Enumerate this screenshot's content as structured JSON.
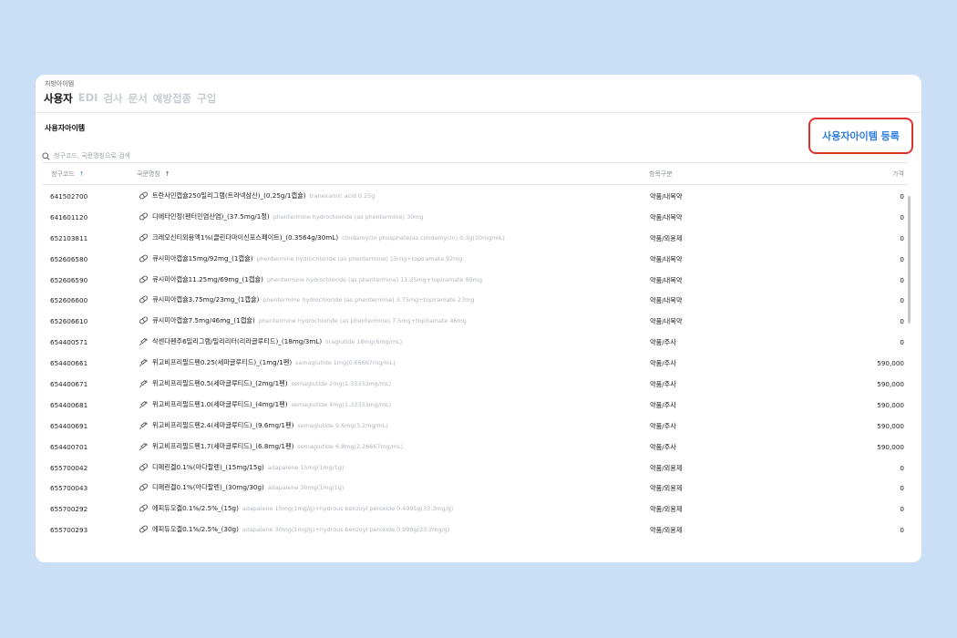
{
  "breadcrumb": "처방아이템",
  "tabs": [
    {
      "label": "사용자",
      "active": true
    },
    {
      "label": "EDI",
      "active": false
    },
    {
      "label": "검사",
      "active": false
    },
    {
      "label": "문서",
      "active": false
    },
    {
      "label": "예방접종",
      "active": false
    },
    {
      "label": "구입",
      "active": false
    }
  ],
  "section_title": "사용자아이템",
  "search": {
    "placeholder": "청구코드, 국문명칭으로 검색",
    "value": ""
  },
  "register_button": "사용자아이템 등록",
  "columns": {
    "code": "청구코드",
    "name": "국문명칭",
    "category": "항목구분",
    "price": "가격"
  },
  "colors": {
    "accent": "#2f7de1",
    "highlight_border": "#e0322c",
    "background": "#c9dff5"
  },
  "rows": [
    {
      "code": "641502700",
      "name": "트란사민캡슐250밀리그램(트라넥삼산)_(0.25g/1캡슐)",
      "ingredient": "tranexamic acid 0.25g",
      "category": "약품/내복약",
      "price": "0",
      "icon": "pill-icon"
    },
    {
      "code": "641601120",
      "name": "디에타민정(펜터민염산염)_(37.5mg/1정)",
      "ingredient": "phentermine hydrochloride (as phentermine) 30mg",
      "category": "약품/내복약",
      "price": "0",
      "icon": "pill-icon"
    },
    {
      "code": "652103811",
      "name": "크레오신티외용액1%(클린다마이신포스페이트)_(0.3564g/30mL)",
      "ingredient": "clindamycin phosphate(as clindamycin) 0.3g(10mg/mL)",
      "category": "약품/외용제",
      "price": "0",
      "icon": "pill-icon"
    },
    {
      "code": "652606580",
      "name": "큐시미아캡슐15mg/92mg_(1캡슐)",
      "ingredient": "phentermine hydrochloride (as phentermine) 15mg+topiramate 92mg",
      "category": "약품/내복약",
      "price": "0",
      "icon": "pill-icon"
    },
    {
      "code": "652606590",
      "name": "큐시미아캡슐11.25mg/69mg_(1캡슐)",
      "ingredient": "phentermine hydrochloride (as phentermine) 11.25mg+topiramate 69mg",
      "category": "약품/내복약",
      "price": "0",
      "icon": "pill-icon"
    },
    {
      "code": "652606600",
      "name": "큐시미아캡슐3.75mg/23mg_(1캡슐)",
      "ingredient": "phentermine hydrochloride (as phentermine) 3.75mg+topiramate 23mg",
      "category": "약품/내복약",
      "price": "0",
      "icon": "pill-icon"
    },
    {
      "code": "652606610",
      "name": "큐시미아캡슐7.5mg/46mg_(1캡슐)",
      "ingredient": "phentermine hydrochloride (as phentermine) 7.5mg+topiramate 46mg",
      "category": "약품/내복약",
      "price": "0",
      "icon": "pill-icon"
    },
    {
      "code": "654400571",
      "name": "삭센다펜주6밀리그램/밀리리터(리라글루티드)_(18mg/3mL)",
      "ingredient": "liraglutide 18mg(6mg/mL)",
      "category": "약품/주사",
      "price": "0",
      "icon": "syringe-icon"
    },
    {
      "code": "654400661",
      "name": "위고비프리필드펜0.25(세마글루티드)_(1mg/1펜)",
      "ingredient": "semaglutide 1mg(0.66667mg/mL)",
      "category": "약품/주사",
      "price": "590,000",
      "icon": "syringe-icon"
    },
    {
      "code": "654400671",
      "name": "위고비프리필드펜0.5(세마글루티드)_(2mg/1펜)",
      "ingredient": "semaglutide 2mg(1.33333mg/mL)",
      "category": "약품/주사",
      "price": "590,000",
      "icon": "syringe-icon"
    },
    {
      "code": "654400681",
      "name": "위고비프리필드펜1.0(세마글루티드)_(4mg/1펜)",
      "ingredient": "semaglutide 4mg(1.33333mg/mL)",
      "category": "약품/주사",
      "price": "590,000",
      "icon": "syringe-icon"
    },
    {
      "code": "654400691",
      "name": "위고비프리필드펜2.4(세마글루티드)_(9.6mg/1펜)",
      "ingredient": "semaglutide 9.6mg(3.2mg/mL)",
      "category": "약품/주사",
      "price": "590,000",
      "icon": "syringe-icon"
    },
    {
      "code": "654400701",
      "name": "위고비프리필드펜1.7(세마글루티드)_(6.8mg/1펜)",
      "ingredient": "semaglutide 6.8mg(2.26667mg/mL)",
      "category": "약품/주사",
      "price": "590,000",
      "icon": "syringe-icon"
    },
    {
      "code": "655700042",
      "name": "디페린겔0.1%(아다팔렌)_(15mg/15g)",
      "ingredient": "adapalene 15mg(1mg/1g)",
      "category": "약품/외용제",
      "price": "0",
      "icon": "pill-icon"
    },
    {
      "code": "655700043",
      "name": "디페린겔0.1%(아다팔렌)_(30mg/30g)",
      "ingredient": "adapalene 30mg(1mg/1g)",
      "category": "약품/외용제",
      "price": "0",
      "icon": "pill-icon"
    },
    {
      "code": "655700292",
      "name": "에피듀오겔0.1%/2.5%_(15g)",
      "ingredient": "adapalene 15mg(1mg/g)+hydrous benzoyl peroxide 0.4995g(33.3mg/g)",
      "category": "약품/외용제",
      "price": "0",
      "icon": "pill-icon"
    },
    {
      "code": "655700293",
      "name": "에피듀오겔0.1%/2.5%_(30g)",
      "ingredient": "adapalene 30mg(1mg/g)+hydrous benzoyl peroxide 0.999g(33.3mg/g)",
      "category": "약품/외용제",
      "price": "0",
      "icon": "pill-icon"
    }
  ]
}
